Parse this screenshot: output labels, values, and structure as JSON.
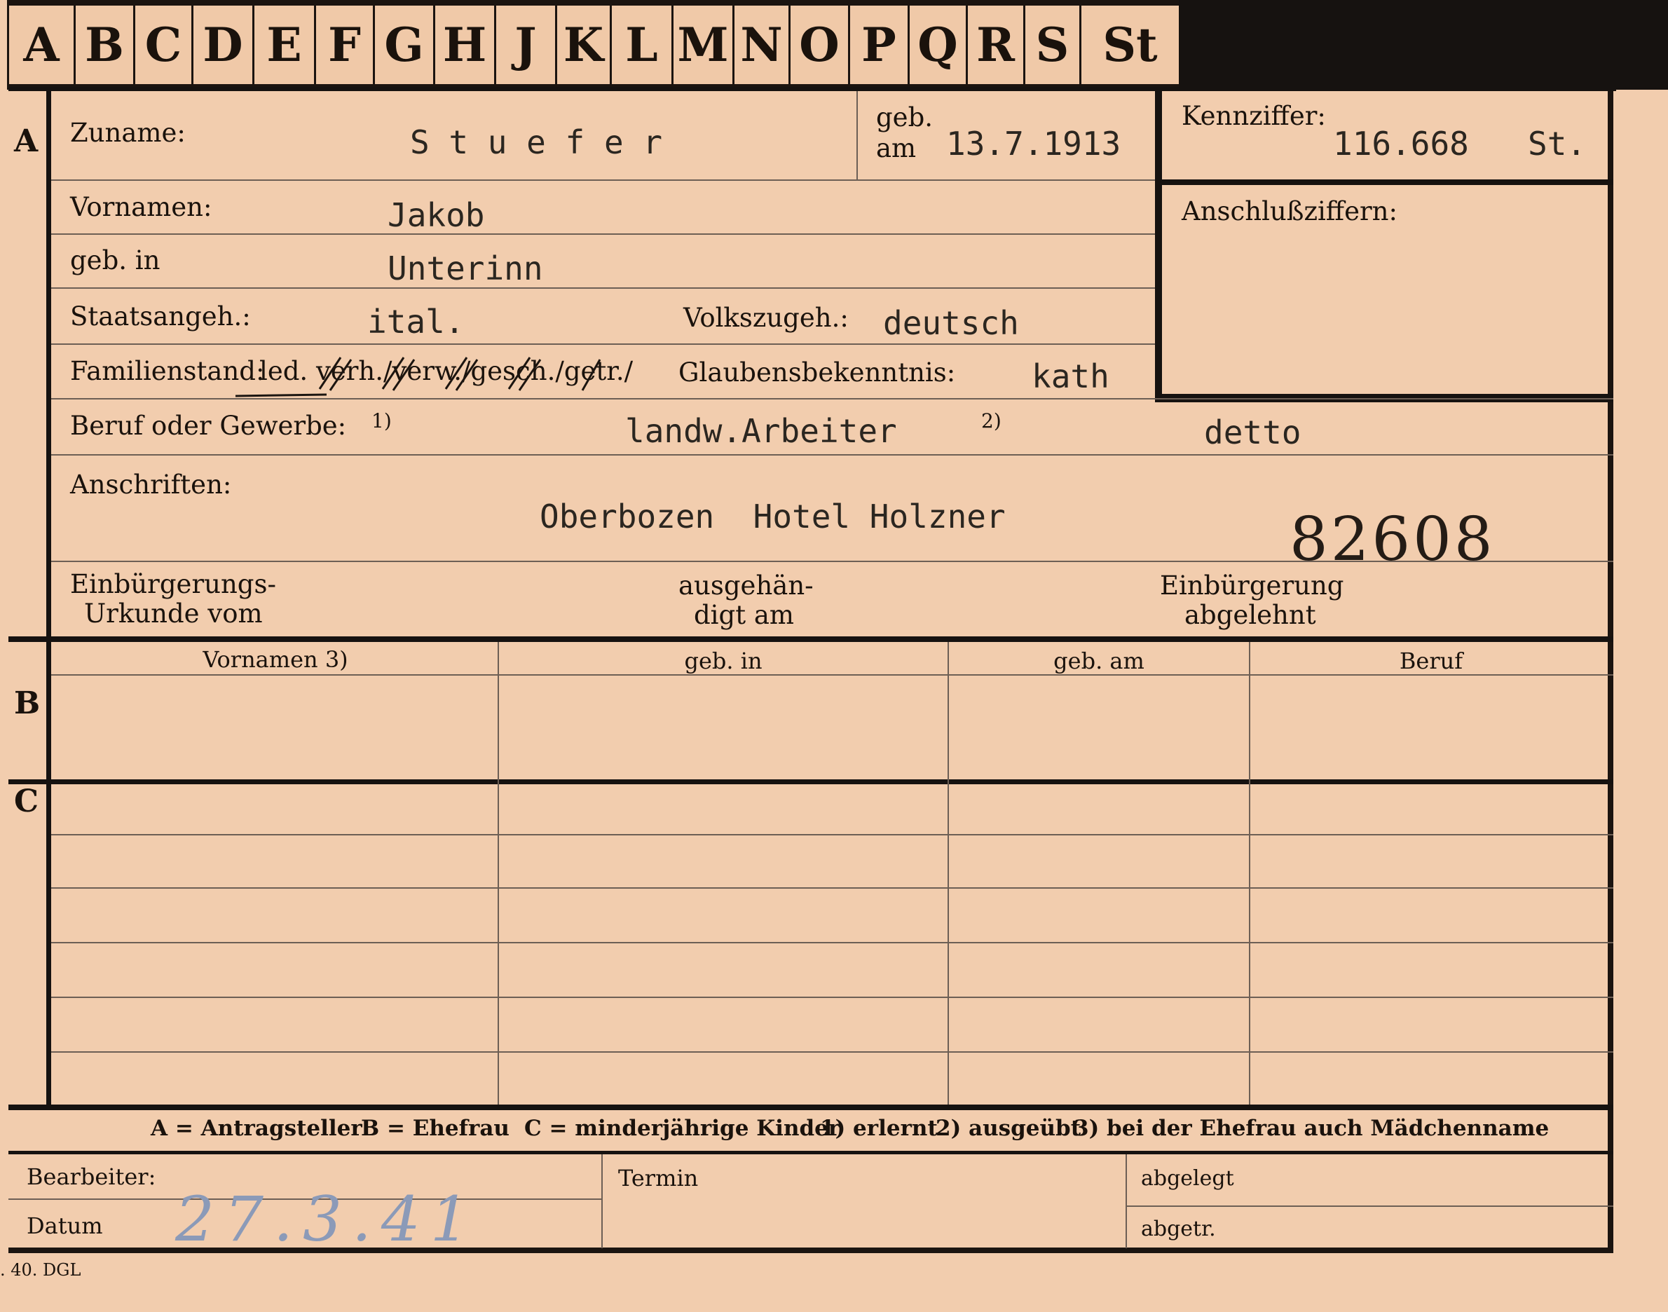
{
  "tabs": [
    "A",
    "B",
    "C",
    "D",
    "E",
    "F",
    "G",
    "H",
    "J",
    "K",
    "L",
    "M",
    "N",
    "O",
    "P",
    "Q",
    "R",
    "S",
    "St"
  ],
  "sections": {
    "a": "A",
    "b": "B",
    "c": "C"
  },
  "header": {
    "zuname_label": "Zuname:",
    "zuname_value": "S t u e f e r",
    "geb_label_1": "geb.",
    "geb_label_2": "am",
    "geb_am_value": "13.7.1913",
    "kennziffer_label": "Kennziffer:",
    "kennziffer_value": "116.668",
    "kennziffer_suffix": "St.",
    "anschluss_label": "Anschlußziffern:"
  },
  "person": {
    "vornamen_label": "Vornamen:",
    "vornamen_value": "Jakob",
    "geb_in_label": "geb. in",
    "geb_in_value": "Unterinn",
    "staatsangeh_label": "Staatsangeh.:",
    "staatsangeh_value": "ital.",
    "volkszugeh_label": "Volkszugeh.:",
    "volkszugeh_value": "deutsch",
    "familienstand_label": "Familienstand:",
    "familienstand_options": "led. verh./verw./gesch./getr./",
    "glaubens_label": "Glaubensbekenntnis:",
    "glaubens_value": "kath",
    "beruf_label": "Beruf oder Gewerbe:",
    "beruf_mark1": "1)",
    "beruf_value1": "landw.Arbeiter",
    "beruf_mark2": "2)",
    "beruf_value2": "detto",
    "anschriften_label": "Anschriften:",
    "anschriften_value": "Oberbozen  Hotel Holzner",
    "stamp_number": "82608",
    "einb_urkunde_1": "Einbürgerungs-",
    "einb_urkunde_2": "Urkunde vom",
    "ausgehaendigt_1": "ausgehän-",
    "ausgehaendigt_2": "digt am",
    "einb_abgelehnt_1": "Einbürgerung",
    "einb_abgelehnt_2": "abgelehnt"
  },
  "family_table": {
    "headers": [
      "Vornamen 3)",
      "geb. in",
      "geb. am",
      "Beruf"
    ]
  },
  "legend": {
    "a": "A = Antragsteller",
    "b": "B = Ehefrau",
    "c": "C = minderjährige Kinder",
    "n1": "1) erlernt",
    "n2": "2) ausgeübt",
    "n3": "3) bei der Ehefrau auch Mädchenname"
  },
  "footer": {
    "bearbeiter_label": "Bearbeiter:",
    "datum_label": "Datum",
    "datum_value": "27.3.41",
    "termin_label": "Termin",
    "abgelegt_label": "abgelegt",
    "abgetr_label": "abgetr.",
    "print_code": ". 40. DGL"
  }
}
